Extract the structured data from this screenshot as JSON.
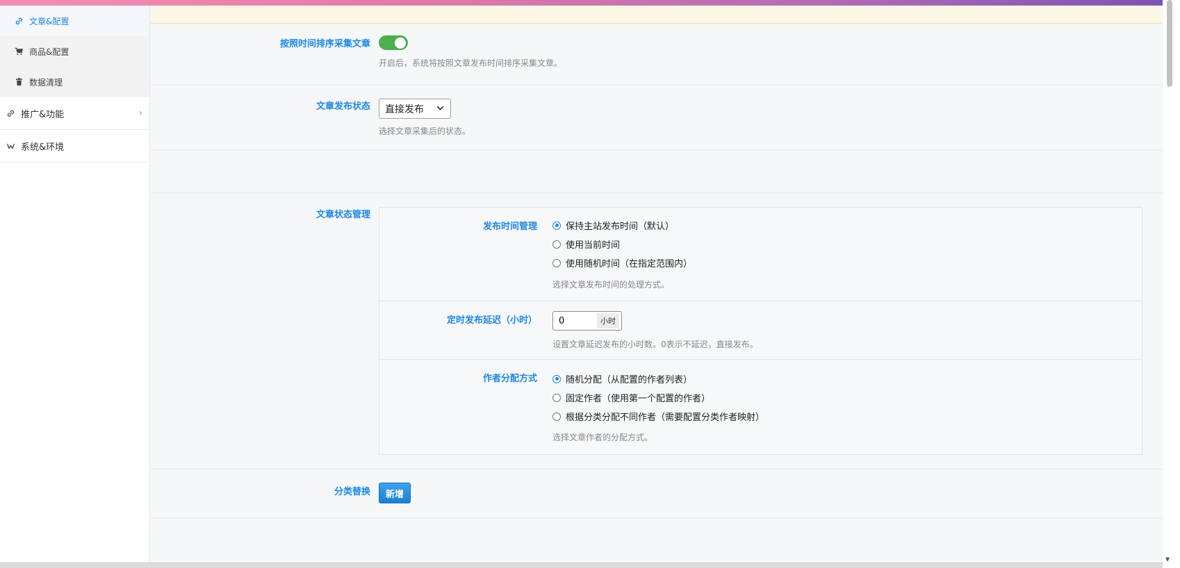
{
  "sidebar": {
    "sub_items": [
      {
        "label": "文章&配置",
        "icon": "link-icon",
        "active": true
      },
      {
        "label": "商品&配置",
        "icon": "cart-icon",
        "active": false
      },
      {
        "label": "数据清理",
        "icon": "trash-icon",
        "active": false
      }
    ],
    "menu_items": [
      {
        "label": "推广&功能",
        "icon": "link-icon",
        "has_submenu": true
      },
      {
        "label": "系统&环境",
        "icon": "settings-icon",
        "has_submenu": false
      }
    ]
  },
  "settings": {
    "sort_by_time": {
      "label": "按照时间排序采集文章",
      "enabled": true,
      "help": "开启后，系统将按照文章发布时间排序采集文章。"
    },
    "publish_status": {
      "label": "文章发布状态",
      "selected": "直接发布",
      "help": "选择文章采集后的状态。"
    },
    "status_management": {
      "label": "文章状态管理",
      "publish_time": {
        "label": "发布时间管理",
        "options": [
          "保持主站发布时间（默认）",
          "使用当前时间",
          "使用随机时间（在指定范围内）"
        ],
        "selected_index": 0,
        "help": "选择文章发布时间的处理方式。"
      },
      "delay": {
        "label": "定时发布延迟（小时）",
        "value": "0",
        "unit": "小时",
        "help": "设置文章延迟发布的小时数。0表示不延迟，直接发布。"
      },
      "author": {
        "label": "作者分配方式",
        "options": [
          "随机分配（从配置的作者列表）",
          "固定作者（使用第一个配置的作者）",
          "根据分类分配不同作者（需要配置分类作者映射）"
        ],
        "selected_index": 0,
        "help": "选择文章作者的分配方式。"
      }
    },
    "category_replace": {
      "label": "分类替换",
      "button": "新增"
    }
  },
  "colors": {
    "accent": "#1e88e5",
    "toggle_on": "#4caf50",
    "notice_bg": "#fdf8e6"
  }
}
